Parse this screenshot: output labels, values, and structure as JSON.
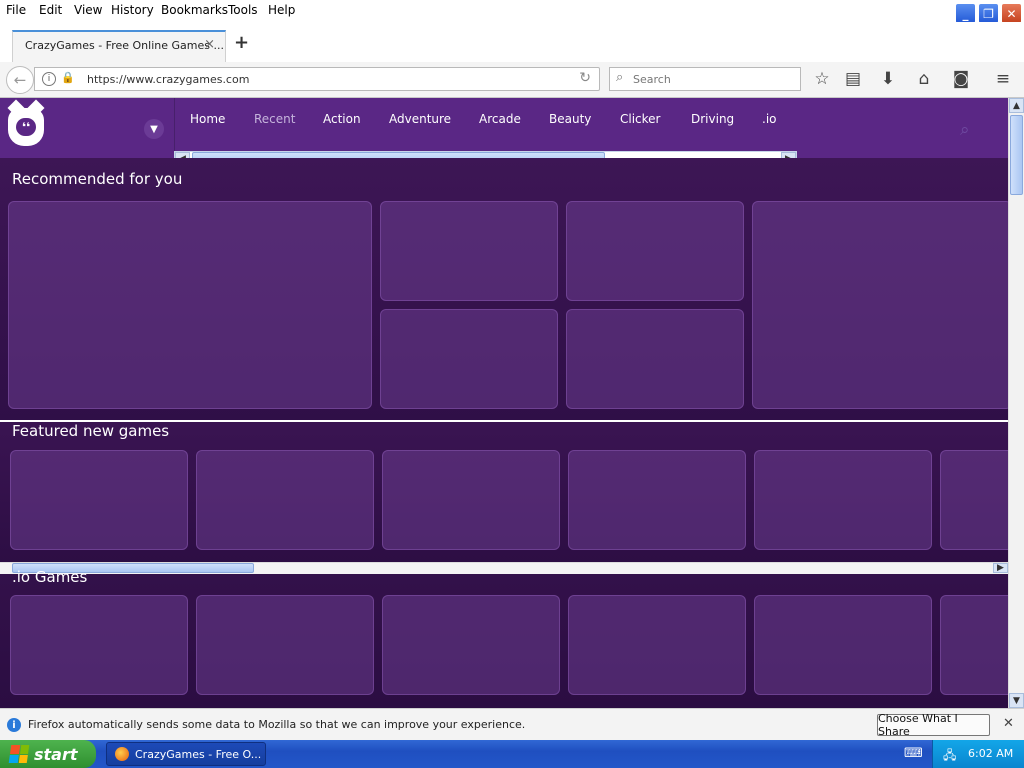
{
  "menubar": {
    "items": [
      "File",
      "Edit",
      "View",
      "History",
      "Bookmarks",
      "Tools",
      "Help"
    ]
  },
  "tab": {
    "title": "CrazyGames - Free Online Games ...",
    "close": "×",
    "new_tab": "+"
  },
  "navbar": {
    "url": "https://www.crazygames.com",
    "search_placeholder": "Search"
  },
  "site": {
    "nav": [
      "Home",
      "Recent",
      "Action",
      "Adventure",
      "Arcade",
      "Beauty",
      "Clicker",
      "Driving",
      ".io"
    ],
    "sections": {
      "recommended": "Recommended for you",
      "featured": "Featured new games",
      "io": ".io Games"
    }
  },
  "notification": {
    "message": "Firefox automatically sends some data to Mozilla so that we can improve your experience.",
    "button": "Choose What I Share"
  },
  "taskbar": {
    "start": "start",
    "item": "CrazyGames - Free O...",
    "time": "6:02 AM"
  },
  "colors": {
    "site_header": "#5a2785",
    "site_bg": "#3a1550",
    "xp_taskbar": "#2357c9"
  }
}
